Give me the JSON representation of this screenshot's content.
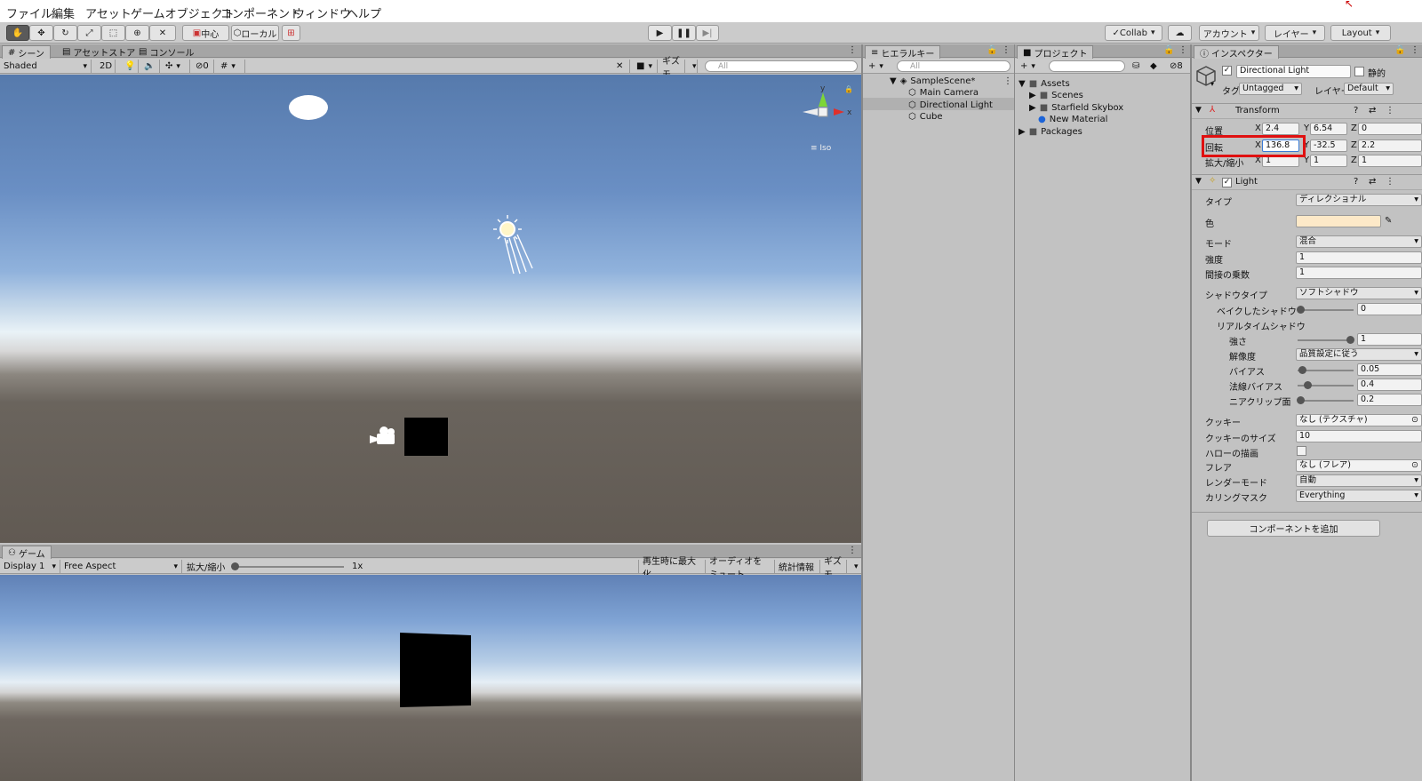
{
  "menu": [
    "ファイル",
    "編集",
    "アセット",
    "ゲームオブジェクト",
    "コンポーネント",
    "ウィンドウ",
    "ヘルプ"
  ],
  "toolbar": {
    "pivot": "中心",
    "space": "ローカル",
    "collab": "Collab",
    "account": "アカウント",
    "layers": "レイヤー",
    "layout": "Layout"
  },
  "scene": {
    "tabs": [
      "シーン",
      "アセットストア",
      "コンソール"
    ],
    "shading": "Shaded",
    "mode2d": "2D",
    "hidden": "0",
    "gizmos": "ギズモ",
    "search": "All",
    "iso": "Iso",
    "axis_y": "y",
    "axis_x": "x"
  },
  "game": {
    "tab": "ゲーム",
    "display": "Display 1",
    "aspect": "Free Aspect",
    "scale_label": "拡大/縮小",
    "scale_value": "1x",
    "buttons": [
      "再生時に最大化",
      "オーディオをミュート",
      "統計情報",
      "ギズモ"
    ]
  },
  "hierarchy": {
    "tab": "ヒエラルキー",
    "search": "All",
    "scene": "SampleScene*",
    "items": [
      "Main Camera",
      "Directional Light",
      "Cube"
    ]
  },
  "project": {
    "tab": "プロジェクト",
    "count": "8",
    "assets": "Assets",
    "children": [
      "Scenes",
      "Starfield Skybox",
      "New Material"
    ],
    "packages": "Packages"
  },
  "inspector": {
    "tab": "インスペクター",
    "object_name": "Directional Light",
    "static": "静的",
    "tag_label": "タグ",
    "tag": "Untagged",
    "layer_label": "レイヤー",
    "layer": "Default",
    "transform": {
      "title": "Transform",
      "position_label": "位置",
      "position": {
        "x": "2.4",
        "y": "6.54",
        "z": "0"
      },
      "rotation_label": "回転",
      "rotation": {
        "x": "136.8",
        "y": "-32.5",
        "z": "2.2"
      },
      "scale_label": "拡大/縮小",
      "scale": {
        "x": "1",
        "y": "1",
        "z": "1"
      }
    },
    "light": {
      "title": "Light",
      "type_label": "タイプ",
      "type": "ディレクショナル",
      "color_label": "色",
      "color": "#fde9c8",
      "mode_label": "モード",
      "mode": "混合",
      "intensity_label": "強度",
      "intensity": "1",
      "indirect_label": "間接の乗数",
      "indirect": "1",
      "shadow_type_label": "シャドウタイプ",
      "shadow_type": "ソフトシャドウ",
      "baked_angle_label": "ベイクしたシャドウアング",
      "baked_angle": "0",
      "realtime_label": "リアルタイムシャドウ",
      "strength_label": "強さ",
      "strength": "1",
      "resolution_label": "解像度",
      "resolution": "品質設定に従う",
      "bias_label": "バイアス",
      "bias": "0.05",
      "normal_bias_label": "法線バイアス",
      "normal_bias": "0.4",
      "near_plane_label": "ニアクリップ面",
      "near_plane": "0.2",
      "cookie_label": "クッキー",
      "cookie": "なし (テクスチャ)",
      "cookie_size_label": "クッキーのサイズ",
      "cookie_size": "10",
      "halo_label": "ハローの描画",
      "flare_label": "フレア",
      "flare": "なし (フレア)",
      "render_mode_label": "レンダーモード",
      "render_mode": "自動",
      "culling_label": "カリングマスク",
      "culling": "Everything"
    },
    "add_component": "コンポーネントを追加"
  },
  "colors": {
    "highlight": "#e01010",
    "panel": "#c2c2c2",
    "ground": "#615a53"
  }
}
